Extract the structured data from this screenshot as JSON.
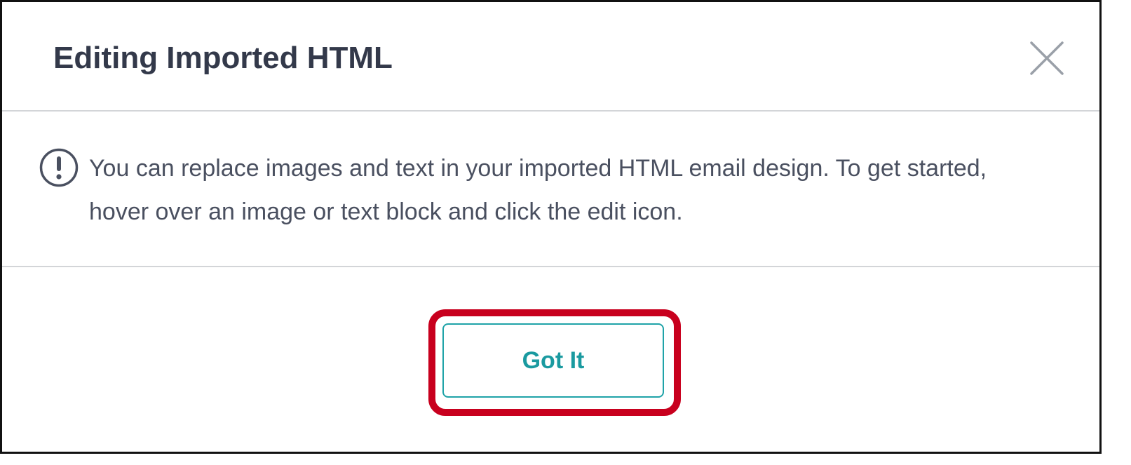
{
  "dialog": {
    "title": "Editing Imported HTML",
    "close_icon": "close-icon",
    "alert_icon": "exclamation-circle-icon",
    "message": "You can replace images and text in your imported HTML email design. To get started, hover over an image or text block and click the edit icon.",
    "confirm_label": "Got It"
  },
  "colors": {
    "title_text": "#33394a",
    "body_text": "#4a5060",
    "accent": "#1a9aa0",
    "highlight": "#c8001e",
    "divider": "#d3d5d8"
  }
}
